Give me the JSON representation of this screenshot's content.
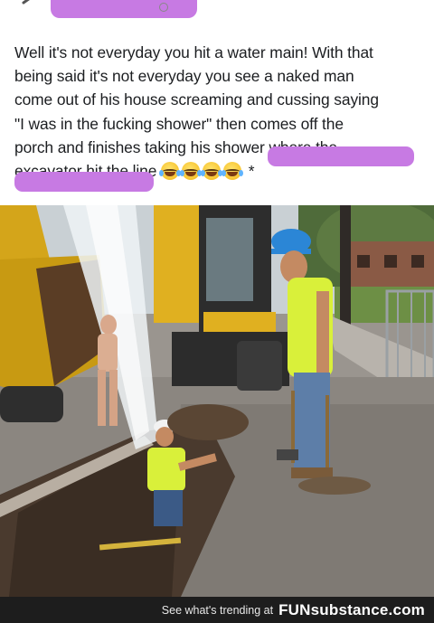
{
  "post": {
    "text_line1": "Well it's not everyday you hit a water main! With that",
    "text_line2": "being said it's not everyday you see a naked man",
    "text_line3": "come out of his house screaming and cussing saying",
    "text_line4": "\"I was in the fucking shower\" then comes off the",
    "text_line5": "porch and finishes taking his shower where the",
    "text_line6": "excavator hit the line",
    "emoji_name": "face-with-tears-of-joy",
    "emoji_count": 4,
    "trailing_asterisk": "*"
  },
  "photo": {
    "colors": {
      "sky": "#cfd6da",
      "road": "#8a8580",
      "excavator_yellow": "#e0b020",
      "vest_yellow": "#d9f03a",
      "hardhat_blue": "#2b86d6",
      "water_spray": "#eef3f6"
    }
  },
  "footer": {
    "tagline": "See what's trending at",
    "brand": "FUNsubstance.com",
    "background": "#1d1d1d"
  },
  "redaction_color": "#c77ae3"
}
